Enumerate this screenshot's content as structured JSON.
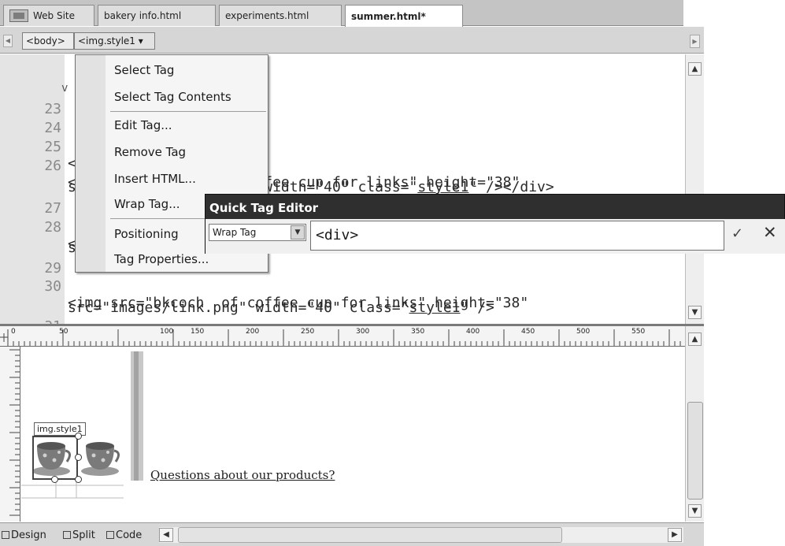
{
  "tabs": [
    {
      "label": "Web Site",
      "active": false
    },
    {
      "label": "bakery info.html",
      "active": false
    },
    {
      "label": "experiments.html",
      "active": false
    },
    {
      "label": "summer.html*",
      "active": true
    }
  ],
  "tag_selector": {
    "body_tag": "<body>",
    "img_tag": "<img.style1 ▾"
  },
  "code": {
    "partial_start": "v",
    "lines": [
      {
        "no": "23",
        "text": ""
      },
      {
        "no": "24",
        "text": ""
      },
      {
        "no": "25",
        "text": "<"
      },
      {
        "no": "26",
        "text": "<                 f coffee cup for links\" height=\"38\""
      },
      {
        "no": "",
        "text": "s                  ng\" width=\"40\" class=\"",
        "u": "style1",
        "tail": "\" /></div>"
      },
      {
        "no": "27",
        "text": ""
      },
      {
        "no": "28",
        "text": "<"
      },
      {
        "no": "",
        "text": "s"
      },
      {
        "no": "29",
        "text": ""
      },
      {
        "no": "30",
        "text": "<img src=\"bkcoch  of coffee cup for links\" height=\"38\""
      },
      {
        "no": "",
        "text": "src=\"images/link.png\" width=\"40\" class=\"",
        "u": "style1",
        "tail": "\" />"
      },
      {
        "no": "31",
        "text": ""
      }
    ]
  },
  "context_menu": {
    "items": [
      {
        "label": "Select Tag"
      },
      {
        "label": "Select Tag Contents"
      },
      {
        "label": "Edit Tag..."
      },
      {
        "label": "Remove Tag"
      },
      {
        "label": "Insert HTML..."
      },
      {
        "label": "Wrap Tag..."
      },
      {
        "label": "Positioning"
      },
      {
        "label": "Tag Properties..."
      }
    ]
  },
  "quick_tag_editor": {
    "title": "Quick Tag Editor",
    "mode": "Wrap Tag",
    "input_value": "<div>",
    "ok": "✓",
    "cancel": "✕"
  },
  "ruler": {
    "ticks": [
      "0",
      "50",
      "100",
      "150",
      "200",
      "250",
      "300",
      "350",
      "400",
      "450",
      "500",
      "550"
    ]
  },
  "design": {
    "image_label": "img.style1",
    "link_text": "Questions about our products?"
  },
  "view_buttons": {
    "design": "Design",
    "split": "Split",
    "code": "Code"
  },
  "colors": {
    "chrome": "#d6d6d6",
    "dialog_title": "#2f2f2f",
    "gutter": "#e4e4e4"
  }
}
